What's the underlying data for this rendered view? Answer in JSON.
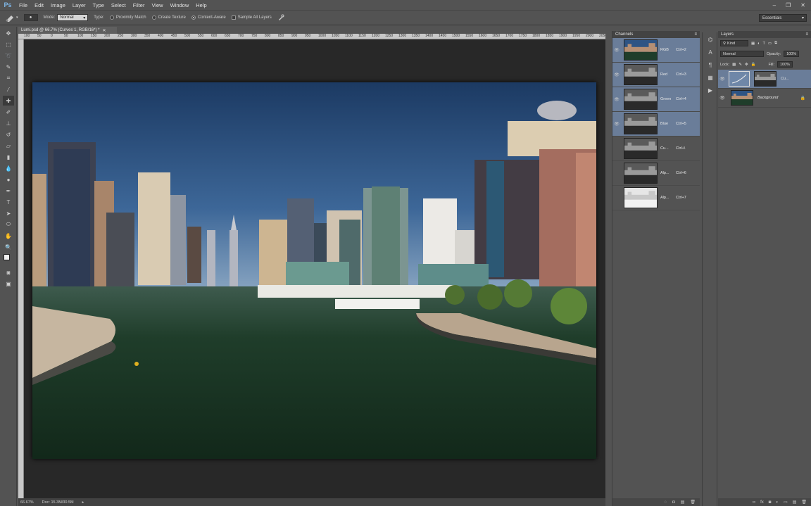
{
  "app": {
    "logo": "Ps"
  },
  "menu": [
    "File",
    "Edit",
    "Image",
    "Layer",
    "Type",
    "Select",
    "Filter",
    "View",
    "Window",
    "Help"
  ],
  "window_controls": {
    "minimize": "–",
    "restore": "❐",
    "close": "✕"
  },
  "options": {
    "mode_label": "Mode:",
    "mode_value": "Normal",
    "type_label": "Type:",
    "proximity": "Proximity Match",
    "texture": "Create Texture",
    "content_aware": "Content-Aware",
    "sample_all": "Sample All Layers",
    "selected_type": "Content-Aware"
  },
  "workspace": "Essentials",
  "document": {
    "tab_title": "Lumi.psd @ 66.7% (Curves 1, RGB/16*) *",
    "zoom": "66.67%",
    "doc_size": "Doc: 15.3M/30.5M"
  },
  "ruler_ticks": [
    "100",
    "50",
    "0",
    "50",
    "100",
    "150",
    "200",
    "250",
    "300",
    "350",
    "400",
    "450",
    "500",
    "550",
    "600",
    "650",
    "700",
    "750",
    "800",
    "850",
    "900",
    "950",
    "1000",
    "1050",
    "1100",
    "1150",
    "1200",
    "1250",
    "1300",
    "1350",
    "1400",
    "1450",
    "1500",
    "1550",
    "1600",
    "1650",
    "1700",
    "1750",
    "1800",
    "1850",
    "1900",
    "1950",
    "2000",
    "2050"
  ],
  "channels": {
    "title": "Channels",
    "rows": [
      {
        "name": "RGB",
        "key": "Ctrl+2",
        "selected": true,
        "visible": true,
        "thumb": "color"
      },
      {
        "name": "Red",
        "key": "Ctrl+3",
        "selected": true,
        "visible": true,
        "thumb": "gray"
      },
      {
        "name": "Green",
        "key": "Ctrl+4",
        "selected": true,
        "visible": true,
        "thumb": "gray"
      },
      {
        "name": "Blue",
        "key": "Ctrl+5",
        "selected": true,
        "visible": true,
        "thumb": "gray"
      },
      {
        "name": "Cu...",
        "key": "Ctrl+\\",
        "selected": false,
        "visible": false,
        "thumb": "gray"
      },
      {
        "name": "Alp...",
        "key": "Ctrl+6",
        "selected": false,
        "visible": false,
        "thumb": "gray"
      },
      {
        "name": "Alp...",
        "key": "Ctrl+7",
        "selected": false,
        "visible": false,
        "thumb": "light"
      }
    ]
  },
  "layers": {
    "title": "Layers",
    "kind": "Kind",
    "blend_mode": "Normal",
    "opacity_label": "Opacity:",
    "opacity": "100%",
    "lock_label": "Lock:",
    "fill_label": "Fill:",
    "fill": "100%",
    "rows": [
      {
        "name": "Cu...",
        "selected": true,
        "type": "adjustment"
      },
      {
        "name": "Background",
        "selected": false,
        "type": "image",
        "locked": true
      }
    ]
  },
  "colors": {
    "selection": "#6a7d99",
    "panel": "#535353",
    "accent": "#7fb6e6"
  }
}
